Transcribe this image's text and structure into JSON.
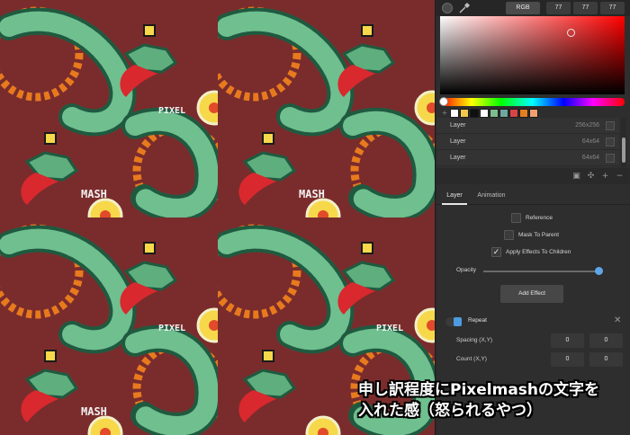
{
  "color_picker": {
    "mode_label": "RGB",
    "r": "77",
    "g": "77",
    "b": "77"
  },
  "palette": {
    "add_label": "+",
    "swatches": [
      "#ffffff",
      "#f2c94c",
      "#101010",
      "#ffffff",
      "#7dbb8f",
      "#6fa6a0",
      "#d64545",
      "#e67e22",
      "#f0a070"
    ]
  },
  "layers": [
    {
      "name": "Layer",
      "size": "256x256"
    },
    {
      "name": "Layer",
      "size": "64x64"
    },
    {
      "name": "Layer",
      "size": "64x64"
    }
  ],
  "tabs": {
    "layer": "Layer",
    "animation": "Animation"
  },
  "layer_props": {
    "reference": "Reference",
    "mask_to_parent": "Mask To Parent",
    "apply_effects": "Apply Effects To Children",
    "apply_effects_checked": true,
    "opacity_label": "Opacity",
    "opacity_value": 1.0,
    "add_effect": "Add Effect"
  },
  "effect": {
    "title": "Repeat",
    "spacing_label": "Spacing (X,Y)",
    "spacing_x": "0",
    "spacing_y": "0",
    "count_label": "Count (X,Y)",
    "count_x": "0",
    "count_y": "0"
  },
  "canvas": {
    "text_pixel": "PIXEL",
    "text_mash": "MASH"
  },
  "caption": {
    "line1": "申し訳程度にPixelmashの文字を",
    "line2": "入れた感（怒られるやつ）"
  },
  "colors": {
    "canvas_bg": "#7a2c2c",
    "dragon_green": "#6fbf8f",
    "dragon_dark": "#1f5a40",
    "tongue_red": "#d9282e",
    "sun_orange": "#e87a1e",
    "orb_yellow": "#f6d84a"
  }
}
